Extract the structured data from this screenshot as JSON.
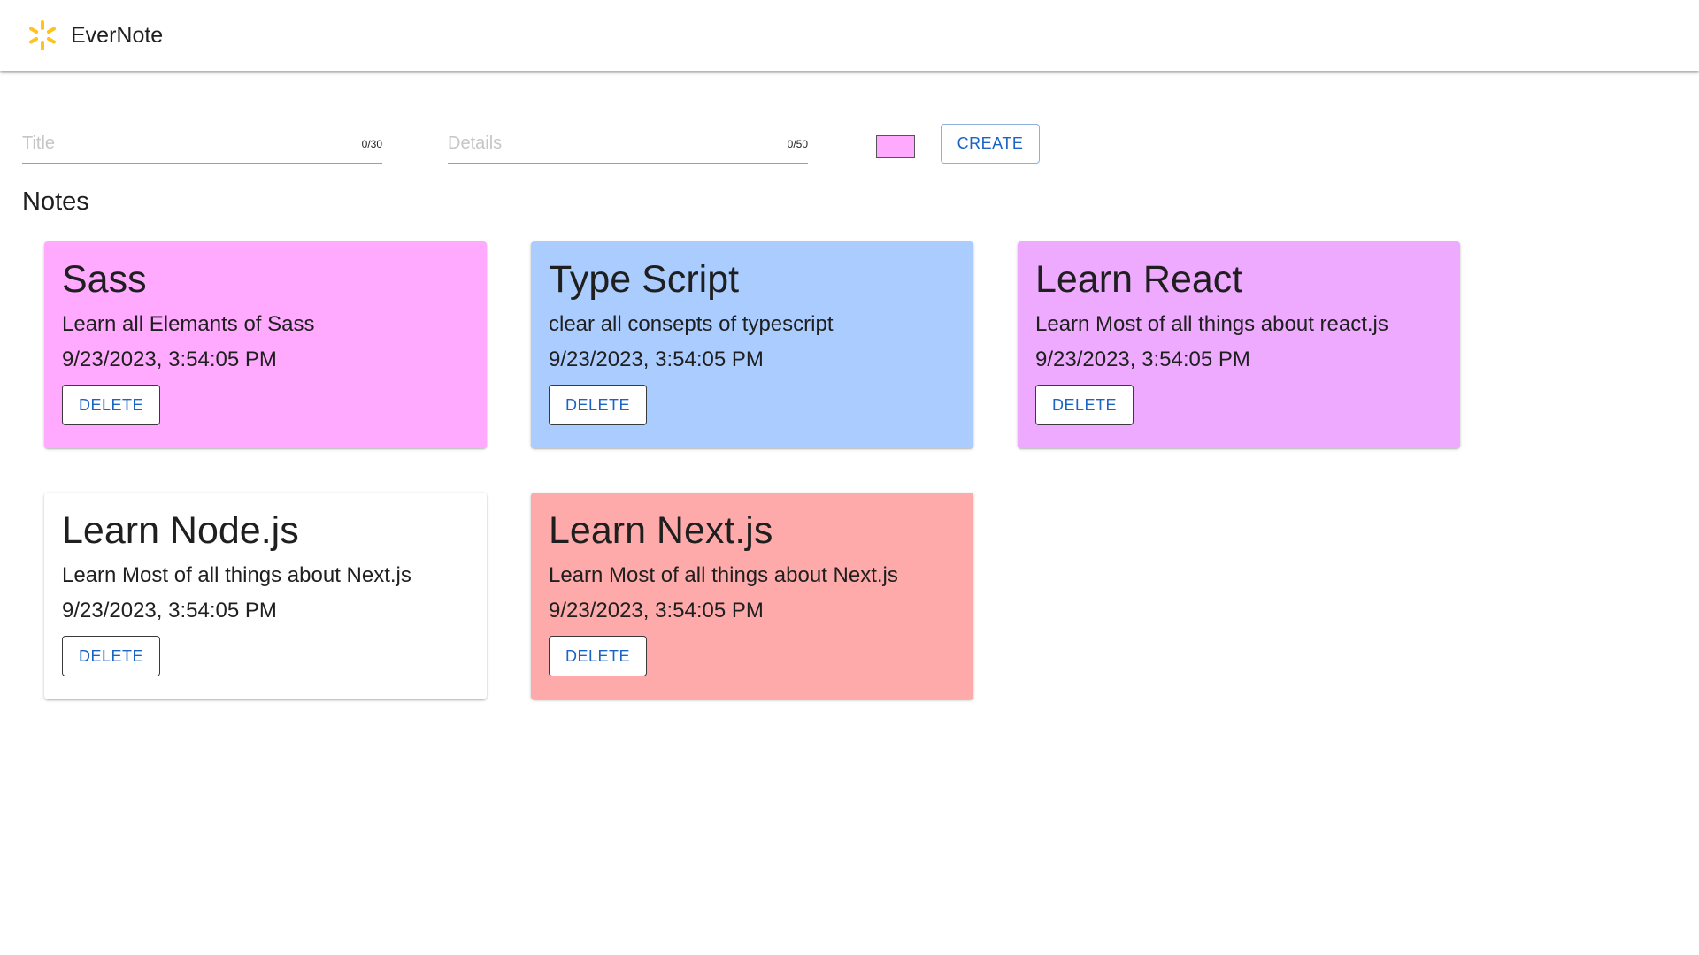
{
  "app": {
    "brand": "EverNote",
    "logo_icon": "spark-icon",
    "logo_color": "#ffc220"
  },
  "form": {
    "title_placeholder": "Title",
    "title_value": "",
    "title_counter": "0/30",
    "details_placeholder": "Details",
    "details_value": "",
    "details_counter": "0/50",
    "selected_color": "#ffaaff",
    "create_label": "CREATE"
  },
  "notes_section": {
    "heading": "Notes"
  },
  "notes": [
    {
      "title": "Sass",
      "details": "Learn all Elemants of Sass",
      "date": "9/23/2023, 3:54:05 PM",
      "color": "#ffaaff",
      "delete_label": "DELETE"
    },
    {
      "title": "Type Script",
      "details": "clear all consepts of typescript",
      "date": "9/23/2023, 3:54:05 PM",
      "color": "#aaccff",
      "delete_label": "DELETE"
    },
    {
      "title": "Learn React",
      "details": "Learn Most of all things about react.js",
      "date": "9/23/2023, 3:54:05 PM",
      "color": "#eeaaff",
      "delete_label": "DELETE"
    },
    {
      "title": "Learn Node.js",
      "details": "Learn Most of all things about Next.js",
      "date": "9/23/2023, 3:54:05 PM",
      "color": "#ffffff",
      "delete_label": "DELETE"
    },
    {
      "title": "Learn Next.js",
      "details": "Learn Most of all things about Next.js",
      "date": "9/23/2023, 3:54:05 PM",
      "color": "#ffaaaa",
      "delete_label": "DELETE"
    }
  ]
}
